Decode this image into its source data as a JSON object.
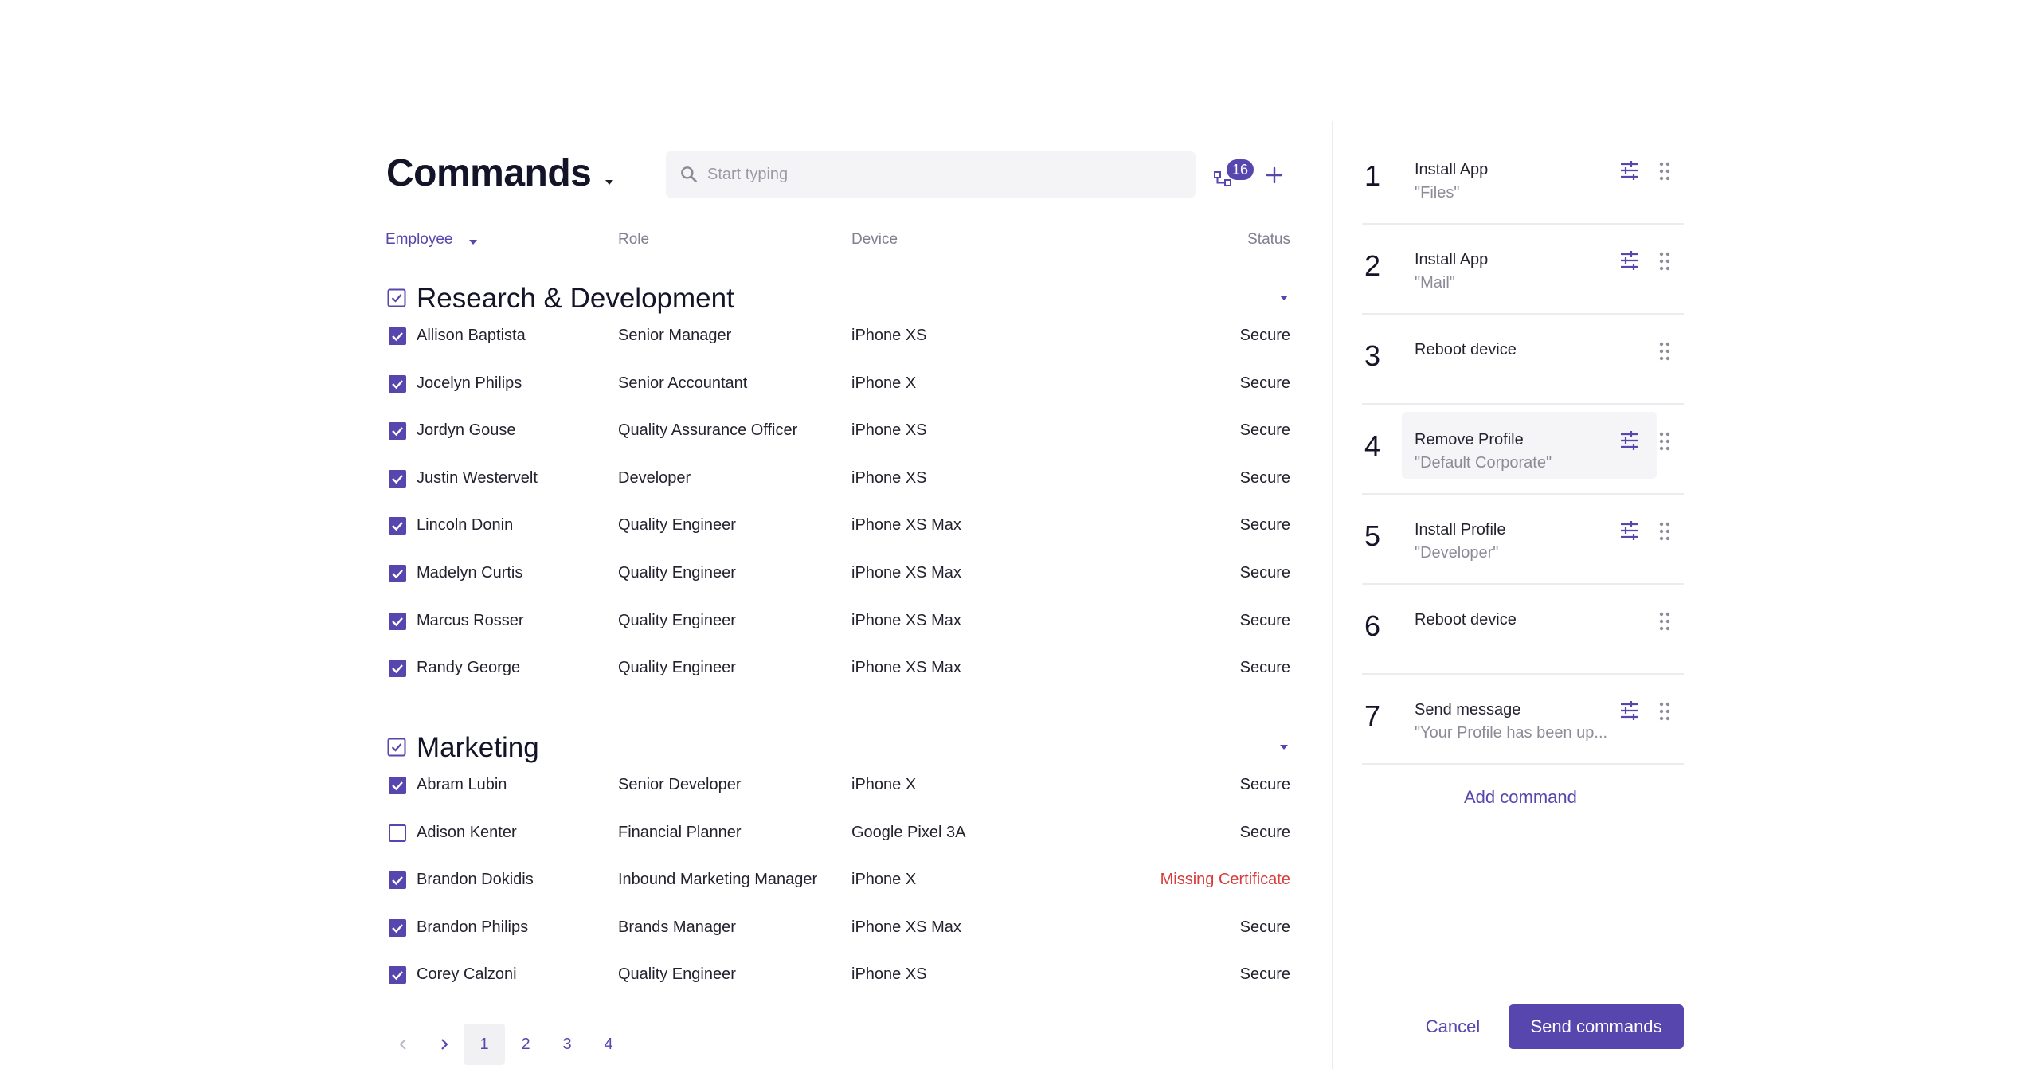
{
  "header": {
    "title": "Commands",
    "search_placeholder": "Start typing",
    "hierarchy_badge": "16"
  },
  "columns": {
    "employee": "Employee",
    "role": "Role",
    "device": "Device",
    "status": "Status"
  },
  "groups": [
    {
      "title": "Research & Development",
      "checked": true,
      "rows": [
        {
          "name": "Allison Baptista",
          "role": "Senior Manager",
          "device": "iPhone XS",
          "status": "Secure",
          "checked": true
        },
        {
          "name": "Jocelyn Philips",
          "role": "Senior Accountant",
          "device": "iPhone X",
          "status": "Secure",
          "checked": true
        },
        {
          "name": "Jordyn Gouse",
          "role": "Quality Assurance Officer",
          "device": "iPhone XS",
          "status": "Secure",
          "checked": true
        },
        {
          "name": "Justin Westervelt",
          "role": "Developer",
          "device": "iPhone XS",
          "status": "Secure",
          "checked": true
        },
        {
          "name": "Lincoln Donin",
          "role": "Quality Engineer",
          "device": "iPhone XS Max",
          "status": "Secure",
          "checked": true
        },
        {
          "name": "Madelyn Curtis",
          "role": "Quality Engineer",
          "device": "iPhone XS Max",
          "status": "Secure",
          "checked": true
        },
        {
          "name": "Marcus Rosser",
          "role": "Quality Engineer",
          "device": "iPhone XS Max",
          "status": "Secure",
          "checked": true
        },
        {
          "name": "Randy George",
          "role": "Quality Engineer",
          "device": "iPhone XS Max",
          "status": "Secure",
          "checked": true
        }
      ]
    },
    {
      "title": "Marketing",
      "checked": true,
      "rows": [
        {
          "name": "Abram Lubin",
          "role": "Senior Developer",
          "device": "iPhone X",
          "status": "Secure",
          "checked": true
        },
        {
          "name": "Adison Kenter",
          "role": "Financial Planner",
          "device": "Google Pixel 3A",
          "status": "Secure",
          "checked": false
        },
        {
          "name": "Brandon Dokidis",
          "role": "Inbound Marketing Manager",
          "device": "iPhone X",
          "status": "Missing Certificate",
          "checked": true,
          "warn": true
        },
        {
          "name": "Brandon Philips",
          "role": "Brands Manager",
          "device": "iPhone XS Max",
          "status": "Secure",
          "checked": true
        },
        {
          "name": "Corey Calzoni",
          "role": "Quality Engineer",
          "device": "iPhone XS",
          "status": "Secure",
          "checked": true
        }
      ]
    }
  ],
  "pagination": {
    "pages": [
      "1",
      "2",
      "3",
      "4"
    ],
    "current": "1"
  },
  "commands": [
    {
      "number": "1",
      "label": "Install App",
      "arg": "\"Files\"",
      "configurable": true
    },
    {
      "number": "2",
      "label": "Install App",
      "arg": "\"Mail\"",
      "configurable": true
    },
    {
      "number": "3",
      "label": "Reboot device",
      "arg": "",
      "configurable": false
    },
    {
      "number": "4",
      "label": "Remove Profile",
      "arg": "\"Default Corporate\"",
      "configurable": true,
      "highlight": true
    },
    {
      "number": "5",
      "label": "Install Profile",
      "arg": "\"Developer\"",
      "configurable": true
    },
    {
      "number": "6",
      "label": "Reboot device",
      "arg": "",
      "configurable": false
    },
    {
      "number": "7",
      "label": "Send message",
      "arg": "\"Your Profile has been up...",
      "configurable": true
    }
  ],
  "actions": {
    "add_command": "Add command",
    "cancel": "Cancel",
    "send": "Send commands"
  },
  "colors": {
    "accent": "#5646ad",
    "warning": "#d93b3b",
    "text": "#232330",
    "muted": "#8c8c98"
  }
}
